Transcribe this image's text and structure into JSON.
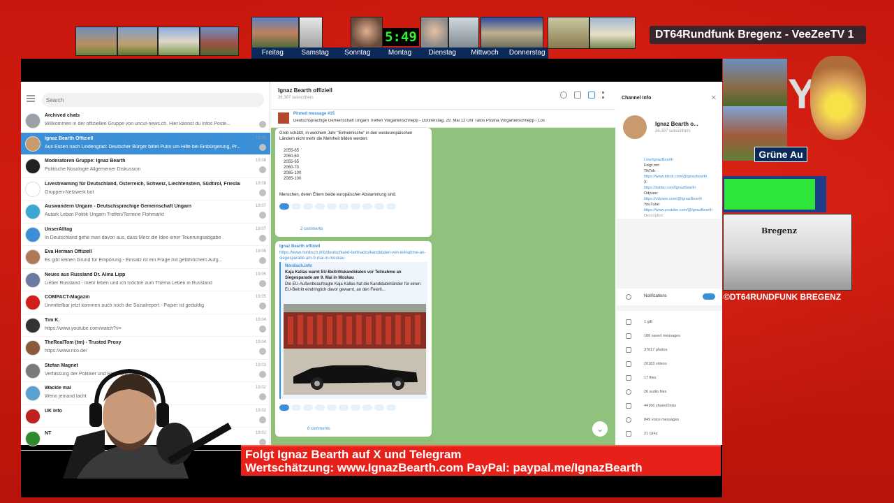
{
  "overlay": {
    "channel_title": "DT64Rundfunk Bregenz - VeeZeeTV 1",
    "clock": "5:49",
    "days": [
      "Freitag",
      "Samstag",
      "Sonntag",
      "Montag",
      "Dienstag",
      "Mittwoch",
      "Donnerstag"
    ],
    "gruene_au": "Grüne Au",
    "bregenz_label": "Bregenz",
    "copyright": "©DT64RUNDFUNK BREGENZ",
    "ticker_line1": "Folgt Ignaz Bearth auf X und Telegram",
    "ticker_line2": "Wertschätzung: www.IgnazBearth.com PayPal: paypal.me/IgnazBearth"
  },
  "sidebar": {
    "search_placeholder": "Search",
    "chats": [
      {
        "name": "Archived chats",
        "preview": "Willkommen in der offiziellen Gruppe von uncut-news.ch. Hier kannst du Infos Poste...",
        "time": "",
        "avatar_color": "#9aa0a6"
      },
      {
        "name": "Ignaz Bearth Offiziell",
        "preview": "Aus Essen nach Lindengrad: Deutscher Bürger bittet Putin um Hilfe bei Einbürgerung, Pr...",
        "time": "19:08",
        "avatar_color": "#c89a6e",
        "active": true
      },
      {
        "name": "Moderatoren Gruppe: Ignaz Bearth",
        "preview": "Politische Nosologie  Allgemeiner Diskussion",
        "time": "19:08",
        "avatar_color": "#222222"
      },
      {
        "name": "Livestreaming für Deutschland, Österreich, Schweiz, Liechtenstein, Südtirol, Friesland",
        "preview": "Gruppen-Netzwerk bot",
        "time": "19:08",
        "avatar_color": "#ffffff"
      },
      {
        "name": "Auswandern Ungarn - Deutschsprachige Gemeinschaft Ungarn",
        "preview": "Autark Leben  Politik Ungarn  Treffen/Termine  Flohmarkt",
        "time": "19:07",
        "avatar_color": "#3aa8d0"
      },
      {
        "name": "UnserAlltag",
        "preview": "In Deutschland gehe man davon aus, dass Merz die Idee einer Teuerungsabgabe",
        "time": "19:07",
        "avatar_color": "#3a8fd6"
      },
      {
        "name": "Eva Herman Offiziell",
        "preview": "Es gibt keinen Grund für Empörung - Einsatz ist ein Frage mit gefährlichem Aufg...",
        "time": "19:06",
        "avatar_color": "#b07a5a"
      },
      {
        "name": "Neues aus Russland  Dr. Alina Lipp",
        "preview": "Lieber Russland - mehr leben und ich möchte zum Thema Leben in Russland",
        "time": "19:05",
        "avatar_color": "#6a7aa0"
      },
      {
        "name": "COMPACT-Magazin",
        "preview": "Unmittelbar jetzt kommen auch noch die Sozialrepert - Papier ist geduldig",
        "time": "19:05",
        "avatar_color": "#d0201a"
      },
      {
        "name": "Tim K.",
        "preview": "https://www.youtube.com/watch?v=",
        "time": "19:04",
        "avatar_color": "#333333"
      },
      {
        "name": "TheRealTom (tm) - Trusted Proxy",
        "preview": "https://www.rico.de/",
        "time": "19:04",
        "avatar_color": "#8a5a3a"
      },
      {
        "name": "Stefan Magnet",
        "preview": "Verfassung der Politiker und Hintergründe",
        "time": "19:03",
        "avatar_color": "#7a7a7a"
      },
      {
        "name": "Wackle mal",
        "preview": "Wenn jemand lacht",
        "time": "19:02",
        "avatar_color": "#5aa0d0"
      },
      {
        "name": "UK Info",
        "preview": "",
        "time": "19:02",
        "avatar_color": "#c02020"
      },
      {
        "name": "NT",
        "preview": "",
        "time": "19:01",
        "avatar_color": "#2e8b2e"
      }
    ]
  },
  "chat": {
    "title": "Ignaz Bearth offiziell",
    "subscribers": "36,397 subscribers",
    "pinned_label": "Pinned message #15",
    "pinned_text": "Deutschsprachige Gemeinschaft Ungarn Treffen Vorgartenschnepp - Donnerstag, 29. Mai 12 Uhr Tátos Postna Vorgartenschnepp - Los",
    "msg1_intro": "Grob schätzt, in welchem Jahr \"Einheimische\" in den westeuropäischen Ländern nicht mehr die Mehrheit bilden werden:",
    "msg1_flags": [
      "2055-65",
      "2050-60",
      "2055-65",
      "2060-70",
      "2085-100",
      "2085-100"
    ],
    "msg1_footer": "Menschen, deren Eltern beide europäischer Abstammung sind.",
    "msg1_comments": "2 comments",
    "msg2_author": "Ignaz Bearth offiziell",
    "msg2_link": "https://www.nordisch.info/deutschland-bettnacks/kandidaten-von-teilnahme-an-siegesparade-am-9-mai-in-moskau",
    "msg2_site": "Nordisch.info",
    "msg2_card_title": "Kaja Kallas warnt EU-Beitrittskandidaten vor Teilnahme an Siegesparade am 9. Mai in Moskau",
    "msg2_card_text": "Die EU-Außenbeauftragte Kaja Kallas hat die Kandidatenländer für einen EU-Beitritt eindringlich davor gewarnt, an den Feierli...",
    "msg2_comments": "8 comments"
  },
  "info": {
    "title": "Channel Info",
    "name": "Ignaz Bearth o...",
    "subscribers": "36,397 subscribers",
    "links": [
      "t.me/IgnazBearth",
      "Folgt mir:",
      "TikTok:",
      "https://www.tiktok.com/@ignazbearth",
      "X:",
      "https://twitter.com/IgnazBearth",
      "Odysee:",
      "https://odysee.com/@IgnazBearth",
      "YouTube:",
      "https://www.youtube.com/@IgnazBearth",
      "Description"
    ],
    "notifications": "Notifications",
    "stats": [
      "1 gift",
      "186 saved messages",
      "37617 photos",
      "20183 videos",
      "17 files",
      "26 audio files",
      "44166 shared links",
      "849 voice messages",
      "21 GIFs"
    ]
  }
}
